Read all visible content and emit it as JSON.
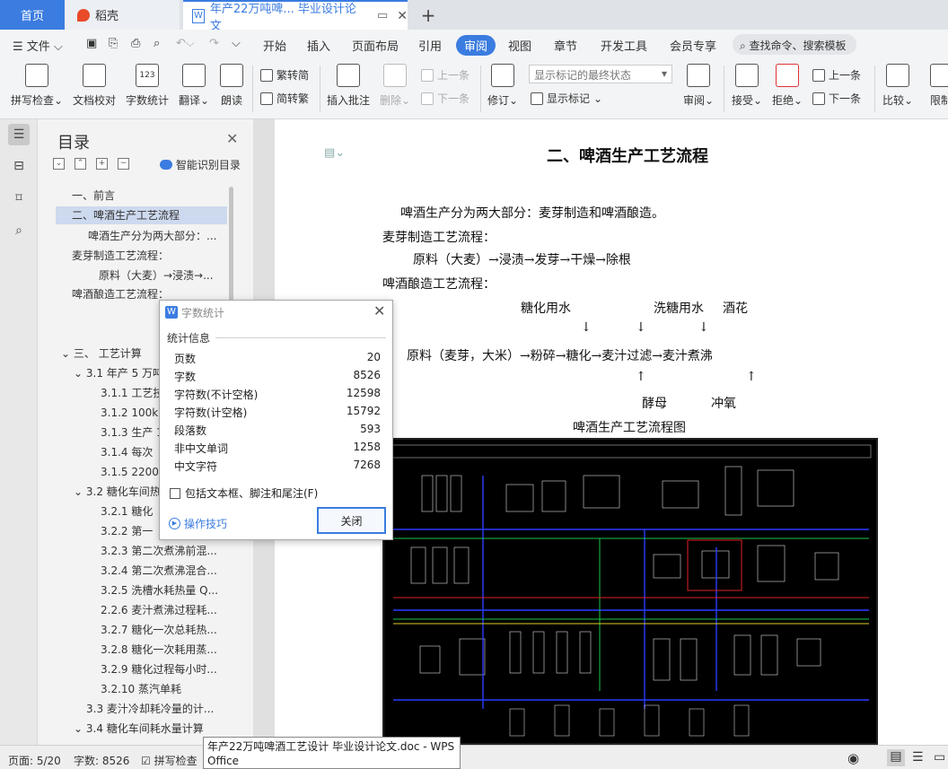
{
  "tabs": {
    "home": "首页",
    "daoke": "稻壳",
    "doc": "年产22万吨啤... 毕业设计论文",
    "add": "+"
  },
  "menu": {
    "file": "文件",
    "items": [
      "开始",
      "插入",
      "页面布局",
      "引用",
      "审阅",
      "视图",
      "章节",
      "开发工具",
      "会员专享"
    ],
    "search": "查找命令、搜索模板"
  },
  "ribbon": {
    "spell_check": "拼写检查",
    "doc_proof": "文档校对",
    "word_count": "字数统计",
    "translate": "翻译",
    "read_aloud": "朗读",
    "trad_simp": "繁转简",
    "simp_trad": "简转繁",
    "insert_comment": "插入批注",
    "delete": "删除",
    "prev_item": "上一条",
    "next_item": "下一条",
    "revise": "修订",
    "markup_select": "显示标记的最终状态",
    "show_markup": "显示标记",
    "review": "审阅",
    "accept": "接受",
    "reject": "拒绝",
    "prev": "上一条",
    "next": "下一条",
    "compare": "比较",
    "restrict": "限制"
  },
  "toc": {
    "title": "目录",
    "smart": "智能识别目录",
    "items": [
      "一、前言",
      "二、啤酒生产工艺流程",
      "啤酒生产分为两大部分：...",
      "麦芽制造工艺流程：",
      "原料（大麦）→浸渍→...",
      "啤酒酿造工艺流程：",
      "三、 工艺计算",
      "3.1 年产 5 万吨",
      "3.1.1 工艺技",
      "3.1.2 100k",
      "3.1.3 生产 1",
      "3.1.4 每次",
      "3.1.5 2200",
      "3.2 糖化车间热",
      "3.2.1 糖化",
      "3.2.2 第一",
      "3.2.3 第二次煮沸前混...",
      "3.2.4 第二次煮沸混合...",
      "3.2.5 洗槽水耗热量 Q...",
      "2.2.6 麦汁煮沸过程耗...",
      "3.2.7 糖化一次总耗热...",
      "3.2.8 糖化一次耗用蒸...",
      "3.2.9 糖化过程每小时...",
      "3.2.10 蒸汽单耗",
      "3.3 麦汁冷却耗冷量的计...",
      "3.4 糖化车间耗水量计算"
    ]
  },
  "doc": {
    "heading": "二、啤酒生产工艺流程",
    "p1": "啤酒生产分为两大部分：麦芽制造和啤酒酿造。",
    "p2": "麦芽制造工艺流程：",
    "p3": "原料（大麦）→浸渍→发芽→干燥→除根",
    "p4": "啤酒酿造工艺流程：",
    "lbl_water": "糖化用水",
    "lbl_wash": "洗糖用水",
    "lbl_hops": "酒花",
    "flow": "原料（麦芽，大米）→粉碎→糖化→麦汁过滤→麦汁煮沸",
    "lbl_yeast": "酵母",
    "lbl_o2": "冲氧",
    "caption": "啤酒生产工艺流程图"
  },
  "dialog": {
    "title": "字数统计",
    "group": "统计信息",
    "rows": [
      {
        "label": "页数",
        "value": "20"
      },
      {
        "label": "字数",
        "value": "8526"
      },
      {
        "label": "字符数(不计空格)",
        "value": "12598"
      },
      {
        "label": "字符数(计空格)",
        "value": "15792"
      },
      {
        "label": "段落数",
        "value": "593"
      },
      {
        "label": "非中文单词",
        "value": "1258"
      },
      {
        "label": "中文字符",
        "value": "7268"
      }
    ],
    "checkbox": "包括文本框、脚注和尾注(F)",
    "tips": "操作技巧",
    "close": "关闭"
  },
  "status": {
    "page": "页面: 5/20",
    "words": "字数: 8526",
    "spell": "拼写检查",
    "tooltip": "年产22万吨啤酒工艺设计 毕业设计论文.doc - WPS Office"
  },
  "colors": {
    "accent": "#3b7ce0",
    "diagram_bg": "#000000"
  }
}
